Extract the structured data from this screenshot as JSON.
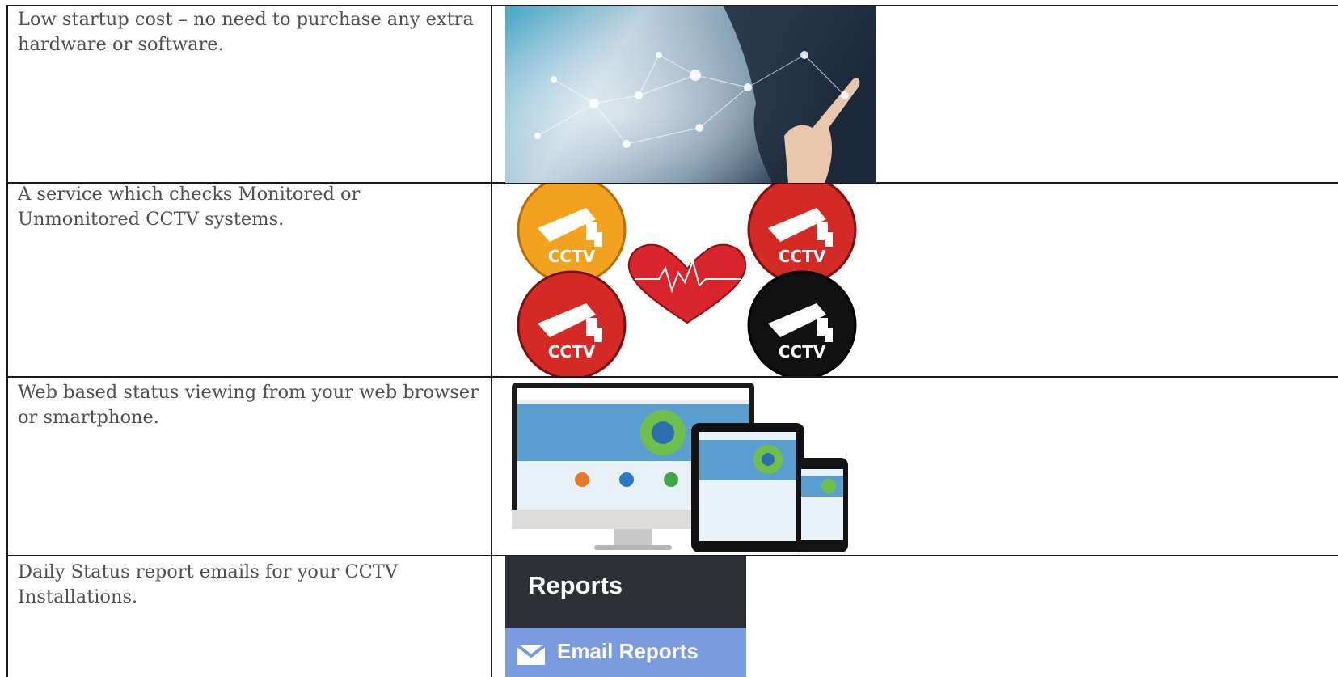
{
  "rows": [
    {
      "text": "Low startup cost – no need to purchase any extra hardware or software.",
      "image": "touch-network-image"
    },
    {
      "text": "A service which checks Monitored or Unmonitored CCTV systems.",
      "image": "cctv-heartbeat-image",
      "badge_label": "CCTV",
      "colors": {
        "orange": "#f2a21e",
        "red": "#d42a25",
        "black": "#111111",
        "heart": "#d8242c"
      }
    },
    {
      "text": "Web based status viewing from your web browser or smartphone.",
      "image": "devices-image"
    },
    {
      "text": "Daily Status report emails for your CCTV Installations.",
      "image": "reports-menu-image",
      "reports": {
        "heading": "Reports",
        "item": "Email Reports",
        "heading_bg": "#2d3035",
        "item_bg": "#7a9be0"
      }
    }
  ]
}
